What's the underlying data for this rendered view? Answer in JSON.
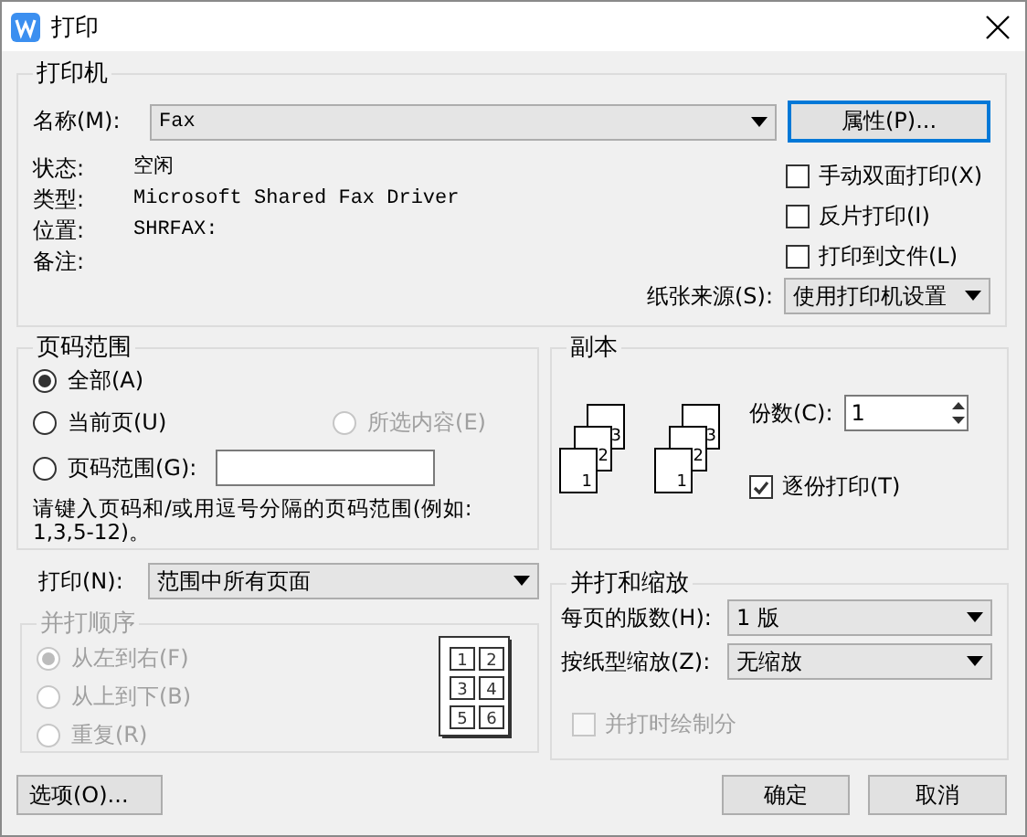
{
  "window": {
    "title": "打印"
  },
  "printer": {
    "group_label": "打印机",
    "name_label": "名称(M):",
    "name_value": "Fax",
    "properties_button": "属性(P)...",
    "info": [
      {
        "label": "状态:",
        "value": "空闲"
      },
      {
        "label": "类型:",
        "value": "Microsoft Shared Fax Driver"
      },
      {
        "label": "位置:",
        "value": "SHRFAX:"
      },
      {
        "label": "备注:"
      }
    ],
    "options": [
      {
        "label": "手动双面打印(X)",
        "checked": false
      },
      {
        "label": "反片打印(I)",
        "checked": false
      },
      {
        "label": "打印到文件(L)",
        "checked": false
      }
    ],
    "paper_source_label": "纸张来源(S):",
    "paper_source_value": "使用打印机设置"
  },
  "page_range": {
    "group_label": "页码范围",
    "options": [
      {
        "label": "全部(A)",
        "selected": true,
        "disabled": false
      },
      {
        "label": "当前页(U)",
        "selected": false,
        "disabled": false
      },
      {
        "label": "所选内容(E)",
        "selected": false,
        "disabled": true
      },
      {
        "label": "页码范围(G):",
        "selected": false,
        "disabled": false
      }
    ],
    "hint": "请键入页码和/或用逗号分隔的页码范围(例如: 1,3,5-12)。"
  },
  "print_what": {
    "label": "打印(N):",
    "value": "范围中所有页面"
  },
  "collate_order": {
    "group_label": "并打顺序",
    "disabled": true,
    "options": [
      {
        "label": "从左到右(F)",
        "selected": true
      },
      {
        "label": "从上到下(B)",
        "selected": false
      },
      {
        "label": "重复(R)",
        "selected": false
      }
    ],
    "preview_pages": [
      "1",
      "2",
      "3",
      "4",
      "5",
      "6"
    ]
  },
  "copies": {
    "group_label": "副本",
    "stacks": [
      {
        "pages": [
          "1",
          "2",
          "3"
        ]
      },
      {
        "pages": [
          "1",
          "2",
          "3"
        ]
      }
    ],
    "count_label": "份数(C):",
    "count_value": "1",
    "collate_label": "逐份打印(T)",
    "collate_checked": true
  },
  "zoom": {
    "group_label": "并打和缩放",
    "pages_per_sheet_label": "每页的版数(H):",
    "pages_per_sheet_value": "1 版",
    "scale_label": "按纸型缩放(Z):",
    "scale_value": "无缩放",
    "borders_label": "并打时绘制分",
    "borders_checked": false,
    "borders_disabled": true
  },
  "buttons": {
    "options": "选项(O)...",
    "ok": "确定",
    "cancel": "取消"
  }
}
